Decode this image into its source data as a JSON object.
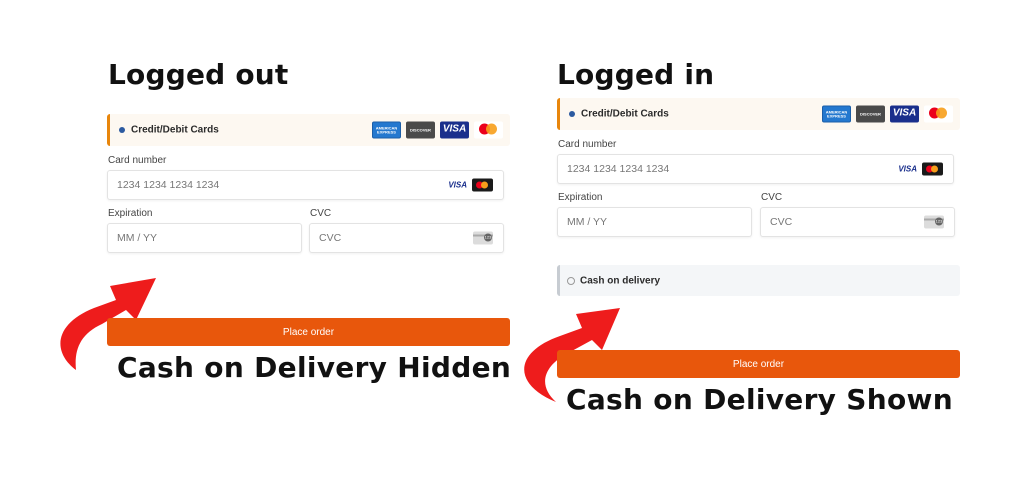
{
  "left": {
    "heading": "Logged out",
    "credit_title": "Credit/Debit Cards",
    "card_number_label": "Card number",
    "card_number_placeholder": "1234 1234 1234 1234",
    "expiration_label": "Expiration",
    "expiration_placeholder": "MM / YY",
    "cvc_label": "CVC",
    "cvc_placeholder": "CVC",
    "place_order": "Place order",
    "caption": "Cash on Delivery Hidden"
  },
  "right": {
    "heading": "Logged in",
    "credit_title": "Credit/Debit Cards",
    "card_number_label": "Card number",
    "card_number_placeholder": "1234 1234 1234 1234",
    "expiration_label": "Expiration",
    "expiration_placeholder": "MM / YY",
    "cvc_label": "CVC",
    "cvc_placeholder": "CVC",
    "cod_title": "Cash on delivery",
    "place_order": "Place order",
    "caption": "Cash on Delivery Shown"
  },
  "card_logos": {
    "amex": "AMERICAN EXPRESS",
    "discover": "DISCOVER",
    "visa": "VISA"
  },
  "colors": {
    "accent_orange": "#e8570c",
    "header_border": "#e8860c",
    "arrow_red": "#ee1c1c"
  },
  "icons": [
    "credit-card-brand-icons",
    "mastercard-icon",
    "visa-icon",
    "cvc-card-icon",
    "curved-arrow-icon"
  ]
}
